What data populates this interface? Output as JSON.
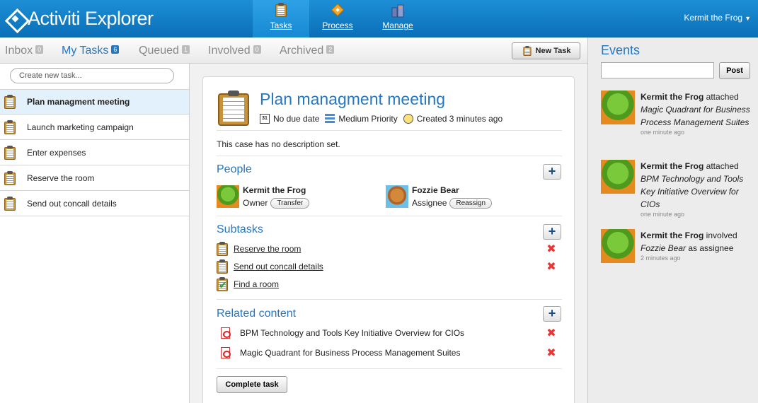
{
  "app": {
    "title": "Activiti Explorer"
  },
  "nav": [
    {
      "label": "Tasks",
      "active": true,
      "icon": "tasks-icon"
    },
    {
      "label": "Process",
      "active": false,
      "icon": "process-icon"
    },
    {
      "label": "Manage",
      "active": false,
      "icon": "manage-icon"
    }
  ],
  "user": {
    "name": "Kermit the Frog"
  },
  "tabs": [
    {
      "label": "Inbox",
      "count": "0"
    },
    {
      "label": "My Tasks",
      "count": "6"
    },
    {
      "label": "Queued",
      "count": "1"
    },
    {
      "label": "Involved",
      "count": "0"
    },
    {
      "label": "Archived",
      "count": "2"
    }
  ],
  "toolbar": {
    "new_task_label": "New Task"
  },
  "tasklist": {
    "create_placeholder": "Create new task...",
    "items": [
      "Plan managment meeting",
      "Launch marketing campaign",
      "Enter expenses",
      "Reserve the room",
      "Send out concall details"
    ]
  },
  "task": {
    "title": "Plan managment meeting",
    "due": "No due date",
    "priority": "Medium Priority",
    "created": "Created 3 minutes ago",
    "description": "This case has no description set.",
    "people_title": "People",
    "people": [
      {
        "name": "Kermit the Frog",
        "role": "Owner",
        "action": "Transfer"
      },
      {
        "name": "Fozzie Bear",
        "role": "Assignee",
        "action": "Reassign"
      }
    ],
    "subtasks_title": "Subtasks",
    "subtasks": [
      {
        "label": "Reserve the room",
        "done": false
      },
      {
        "label": "Send out concall details",
        "done": false
      },
      {
        "label": "Find a room",
        "done": true
      }
    ],
    "related_title": "Related content",
    "related": [
      "BPM Technology and Tools Key Initiative Overview for CIOs",
      "Magic Quadrant for Business Process Management Suites"
    ],
    "complete_label": "Complete task"
  },
  "events": {
    "title": "Events",
    "post_label": "Post",
    "items": [
      {
        "actor": "Kermit the Frog",
        "verb": " attached",
        "object": "Magic Quadrant for Business Process Management Suites",
        "suffix": "",
        "time": "one minute ago"
      },
      {
        "actor": "Kermit the Frog",
        "verb": " attached",
        "object": "BPM Technology and Tools Key Initiative Overview for CIOs",
        "suffix": "",
        "time": "one minute ago"
      },
      {
        "actor": "Kermit the Frog",
        "verb": " involved",
        "object": "Fozzie Bear",
        "suffix": " as assignee",
        "time": "2 minutes ago"
      }
    ]
  }
}
